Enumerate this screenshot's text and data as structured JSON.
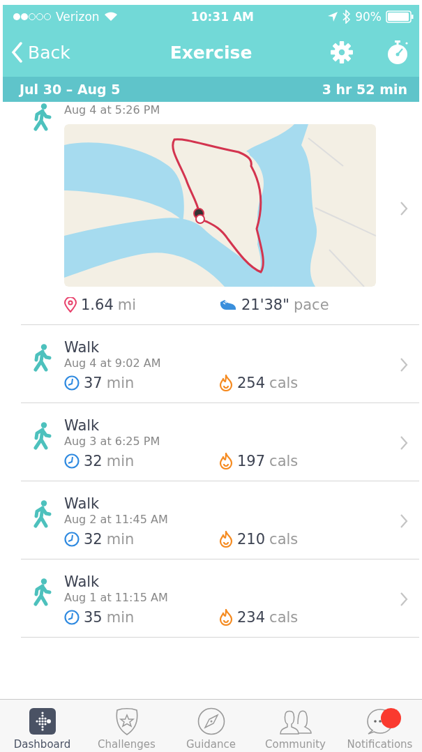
{
  "status_bar": {
    "carrier": "Verizon",
    "time": "10:31 AM",
    "battery": "90%"
  },
  "nav": {
    "back": "Back",
    "title": "Exercise"
  },
  "period": {
    "range": "Jul 30 – Aug 5",
    "total": "3 hr 52 min"
  },
  "activities": [
    {
      "kind": "map",
      "date": "Aug 4 at 5:26 PM",
      "stats": [
        {
          "kind": "distance",
          "value": "1.64",
          "unit": "mi"
        },
        {
          "kind": "pace",
          "value": "21'38\"",
          "unit": "pace"
        }
      ]
    },
    {
      "kind": "plain",
      "title": "Walk",
      "date": "Aug 4 at 9:02 AM",
      "stats": [
        {
          "kind": "duration",
          "value": "37",
          "unit": "min"
        },
        {
          "kind": "calories",
          "value": "254",
          "unit": "cals"
        }
      ]
    },
    {
      "kind": "plain",
      "title": "Walk",
      "date": "Aug 3 at 6:25 PM",
      "stats": [
        {
          "kind": "duration",
          "value": "32",
          "unit": "min"
        },
        {
          "kind": "calories",
          "value": "197",
          "unit": "cals"
        }
      ]
    },
    {
      "kind": "plain",
      "title": "Walk",
      "date": "Aug 2 at 11:45 AM",
      "stats": [
        {
          "kind": "duration",
          "value": "32",
          "unit": "min"
        },
        {
          "kind": "calories",
          "value": "210",
          "unit": "cals"
        }
      ]
    },
    {
      "kind": "plain",
      "title": "Walk",
      "date": "Aug 1 at 11:15 AM",
      "stats": [
        {
          "kind": "duration",
          "value": "35",
          "unit": "min"
        },
        {
          "kind": "calories",
          "value": "234",
          "unit": "cals"
        }
      ]
    }
  ],
  "tabs": [
    {
      "label": "Dashboard",
      "selected": true,
      "badge": false
    },
    {
      "label": "Challenges",
      "selected": false,
      "badge": false
    },
    {
      "label": "Guidance",
      "selected": false,
      "badge": false
    },
    {
      "label": "Community",
      "selected": false,
      "badge": false
    },
    {
      "label": "Notifications",
      "selected": false,
      "badge": true
    }
  ]
}
